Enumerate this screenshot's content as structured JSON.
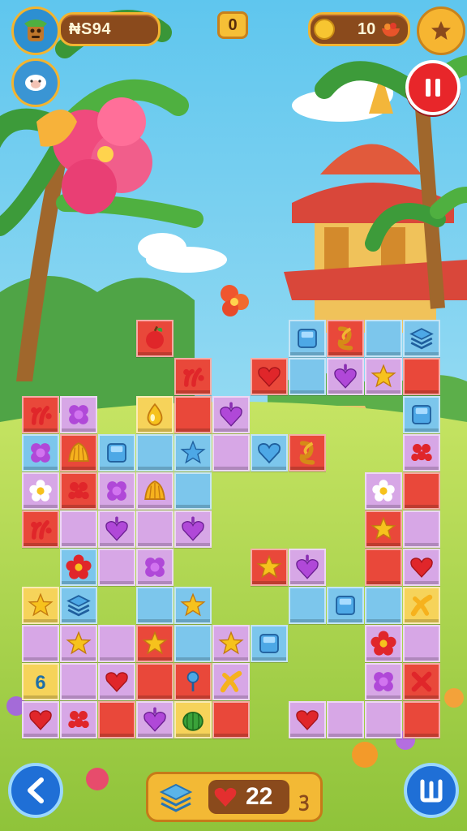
{
  "hud": {
    "coin_balance": "₦S94",
    "score": "0",
    "fruit_count": "10"
  },
  "bottom_bar": {
    "lives_count": "22",
    "extra_symbol": "ꝫ"
  },
  "board": {
    "tiles": [
      {
        "c": 3,
        "r": 0,
        "color": "red",
        "icon": "apple"
      },
      {
        "c": 7,
        "r": 0,
        "color": "blue",
        "icon": "cube"
      },
      {
        "c": 8,
        "r": 0,
        "color": "red",
        "icon": "knot"
      },
      {
        "c": 9,
        "r": 0,
        "color": "blue",
        "icon": "none"
      },
      {
        "c": 10,
        "r": 0,
        "color": "blue",
        "icon": "layers"
      },
      {
        "c": 4,
        "r": 1,
        "color": "red",
        "icon": "sprout"
      },
      {
        "c": 6,
        "r": 1,
        "color": "red",
        "icon": "heart-red"
      },
      {
        "c": 7,
        "r": 1,
        "color": "blue",
        "icon": "none"
      },
      {
        "c": 8,
        "r": 1,
        "color": "purple",
        "icon": "heart-purple"
      },
      {
        "c": 9,
        "r": 1,
        "color": "purple",
        "icon": "star"
      },
      {
        "c": 10,
        "r": 1,
        "color": "red",
        "icon": "none"
      },
      {
        "c": 0,
        "r": 2,
        "color": "red",
        "icon": "sprout"
      },
      {
        "c": 1,
        "r": 2,
        "color": "purple",
        "icon": "flower-purple"
      },
      {
        "c": 3,
        "r": 2,
        "color": "yellow",
        "icon": "drop"
      },
      {
        "c": 4,
        "r": 2,
        "color": "red",
        "icon": "none"
      },
      {
        "c": 5,
        "r": 2,
        "color": "purple",
        "icon": "heart-purple"
      },
      {
        "c": 10,
        "r": 2,
        "color": "blue",
        "icon": "cube"
      },
      {
        "c": 0,
        "r": 3,
        "color": "blue",
        "icon": "flower-purple"
      },
      {
        "c": 1,
        "r": 3,
        "color": "red",
        "icon": "bell"
      },
      {
        "c": 2,
        "r": 3,
        "color": "blue",
        "icon": "cube"
      },
      {
        "c": 3,
        "r": 3,
        "color": "blue",
        "icon": "none"
      },
      {
        "c": 4,
        "r": 3,
        "color": "blue",
        "icon": "star-blue"
      },
      {
        "c": 5,
        "r": 3,
        "color": "purple",
        "icon": "none"
      },
      {
        "c": 6,
        "r": 3,
        "color": "blue",
        "icon": "heart-blue"
      },
      {
        "c": 7,
        "r": 3,
        "color": "red",
        "icon": "knot"
      },
      {
        "c": 10,
        "r": 3,
        "color": "purple",
        "icon": "berries"
      },
      {
        "c": 0,
        "r": 4,
        "color": "purple",
        "icon": "flower-white"
      },
      {
        "c": 1,
        "r": 4,
        "color": "red",
        "icon": "berries"
      },
      {
        "c": 2,
        "r": 4,
        "color": "purple",
        "icon": "flower-purple"
      },
      {
        "c": 3,
        "r": 4,
        "color": "purple",
        "icon": "bell"
      },
      {
        "c": 4,
        "r": 4,
        "color": "blue",
        "icon": "none"
      },
      {
        "c": 9,
        "r": 4,
        "color": "purple",
        "icon": "flower-white"
      },
      {
        "c": 10,
        "r": 4,
        "color": "red",
        "icon": "none"
      },
      {
        "c": 0,
        "r": 5,
        "color": "red",
        "icon": "sprout"
      },
      {
        "c": 1,
        "r": 5,
        "color": "purple",
        "icon": "none"
      },
      {
        "c": 2,
        "r": 5,
        "color": "purple",
        "icon": "heart-purple"
      },
      {
        "c": 3,
        "r": 5,
        "color": "purple",
        "icon": "none"
      },
      {
        "c": 4,
        "r": 5,
        "color": "purple",
        "icon": "heart-purple"
      },
      {
        "c": 9,
        "r": 5,
        "color": "red",
        "icon": "star"
      },
      {
        "c": 10,
        "r": 5,
        "color": "purple",
        "icon": "none"
      },
      {
        "c": 1,
        "r": 6,
        "color": "blue",
        "icon": "flower-red"
      },
      {
        "c": 2,
        "r": 6,
        "color": "purple",
        "icon": "none"
      },
      {
        "c": 3,
        "r": 6,
        "color": "purple",
        "icon": "flower-purple"
      },
      {
        "c": 6,
        "r": 6,
        "color": "red",
        "icon": "star"
      },
      {
        "c": 7,
        "r": 6,
        "color": "purple",
        "icon": "heart-purple"
      },
      {
        "c": 9,
        "r": 6,
        "color": "red",
        "icon": "none"
      },
      {
        "c": 10,
        "r": 6,
        "color": "purple",
        "icon": "heart-red"
      },
      {
        "c": 0,
        "r": 7,
        "color": "yellow",
        "icon": "star"
      },
      {
        "c": 1,
        "r": 7,
        "color": "blue",
        "icon": "layers"
      },
      {
        "c": 3,
        "r": 7,
        "color": "blue",
        "icon": "none"
      },
      {
        "c": 4,
        "r": 7,
        "color": "blue",
        "icon": "star"
      },
      {
        "c": 7,
        "r": 7,
        "color": "blue",
        "icon": "none"
      },
      {
        "c": 8,
        "r": 7,
        "color": "blue",
        "icon": "cube"
      },
      {
        "c": 9,
        "r": 7,
        "color": "blue",
        "icon": "none"
      },
      {
        "c": 10,
        "r": 7,
        "color": "yellow",
        "icon": "ribbon"
      },
      {
        "c": 0,
        "r": 8,
        "color": "purple",
        "icon": "none"
      },
      {
        "c": 1,
        "r": 8,
        "color": "purple",
        "icon": "star"
      },
      {
        "c": 2,
        "r": 8,
        "color": "purple",
        "icon": "none"
      },
      {
        "c": 3,
        "r": 8,
        "color": "red",
        "icon": "star"
      },
      {
        "c": 4,
        "r": 8,
        "color": "blue",
        "icon": "none"
      },
      {
        "c": 5,
        "r": 8,
        "color": "purple",
        "icon": "star"
      },
      {
        "c": 6,
        "r": 8,
        "color": "blue",
        "icon": "cube"
      },
      {
        "c": 9,
        "r": 8,
        "color": "purple",
        "icon": "flower-red"
      },
      {
        "c": 10,
        "r": 8,
        "color": "purple",
        "icon": "none"
      },
      {
        "c": 0,
        "r": 9,
        "color": "yellow",
        "icon": "six"
      },
      {
        "c": 1,
        "r": 9,
        "color": "purple",
        "icon": "none"
      },
      {
        "c": 2,
        "r": 9,
        "color": "purple",
        "icon": "heart-red"
      },
      {
        "c": 3,
        "r": 9,
        "color": "red",
        "icon": "none"
      },
      {
        "c": 4,
        "r": 9,
        "color": "red",
        "icon": "pin"
      },
      {
        "c": 5,
        "r": 9,
        "color": "purple",
        "icon": "ribbon"
      },
      {
        "c": 9,
        "r": 9,
        "color": "purple",
        "icon": "flower-purple"
      },
      {
        "c": 10,
        "r": 9,
        "color": "red",
        "icon": "cross"
      },
      {
        "c": 0,
        "r": 10,
        "color": "purple",
        "icon": "heart-red"
      },
      {
        "c": 1,
        "r": 10,
        "color": "purple",
        "icon": "berries"
      },
      {
        "c": 2,
        "r": 10,
        "color": "red",
        "icon": "none"
      },
      {
        "c": 3,
        "r": 10,
        "color": "purple",
        "icon": "heart-purple"
      },
      {
        "c": 4,
        "r": 10,
        "color": "yellow",
        "icon": "melon"
      },
      {
        "c": 5,
        "r": 10,
        "color": "red",
        "icon": "none"
      },
      {
        "c": 7,
        "r": 10,
        "color": "purple",
        "icon": "heart-red"
      },
      {
        "c": 8,
        "r": 10,
        "color": "purple",
        "icon": "none"
      },
      {
        "c": 9,
        "r": 10,
        "color": "purple",
        "icon": "none"
      },
      {
        "c": 10,
        "r": 10,
        "color": "red",
        "icon": "none"
      }
    ]
  },
  "colors": {
    "tile_red": "#e9483a",
    "tile_blue": "#7cc6ec",
    "tile_purple": "#d7a7e6",
    "tile_yellow": "#f6d35a",
    "sky": "#7fd3f2",
    "grass": "#b7dc55",
    "pause_red": "#e8262a",
    "nav_blue": "#1f6fd6"
  }
}
